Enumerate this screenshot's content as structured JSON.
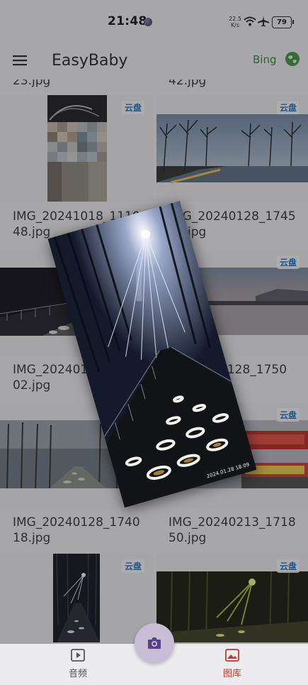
{
  "status": {
    "time": "21:48",
    "net_speed_value": "22.5",
    "net_speed_unit": "K/s",
    "battery": "79"
  },
  "appbar": {
    "title": "EasyBaby",
    "bing_label": "Bing"
  },
  "badge_text": "云盘",
  "files": {
    "r0_left": "23.jpg",
    "r0_right": "42.jpg",
    "r1_left": "IMG_20241018_111048.jpg",
    "r1_right": "IMG_20240128_174548.jpg",
    "r2_left": "IMG_2024012",
    "r2_left_tail": "02.jpg",
    "r2_right": "0128_1750",
    "r2_right_tail": "02.jpg",
    "r3_left": "IMG_20240128_174018.jpg",
    "r3_right": "IMG_20240213_171850.jpg"
  },
  "photo_stamp": "2024.01.28  18:09",
  "bottom_nav": {
    "audio_label": "音频",
    "gallery_label": "图库"
  },
  "colors": {
    "accent_red": "#c0392b",
    "bing_green": "#2f8a2f",
    "badge_blue": "#1c6ec2",
    "fab": "#c9bdd6"
  }
}
